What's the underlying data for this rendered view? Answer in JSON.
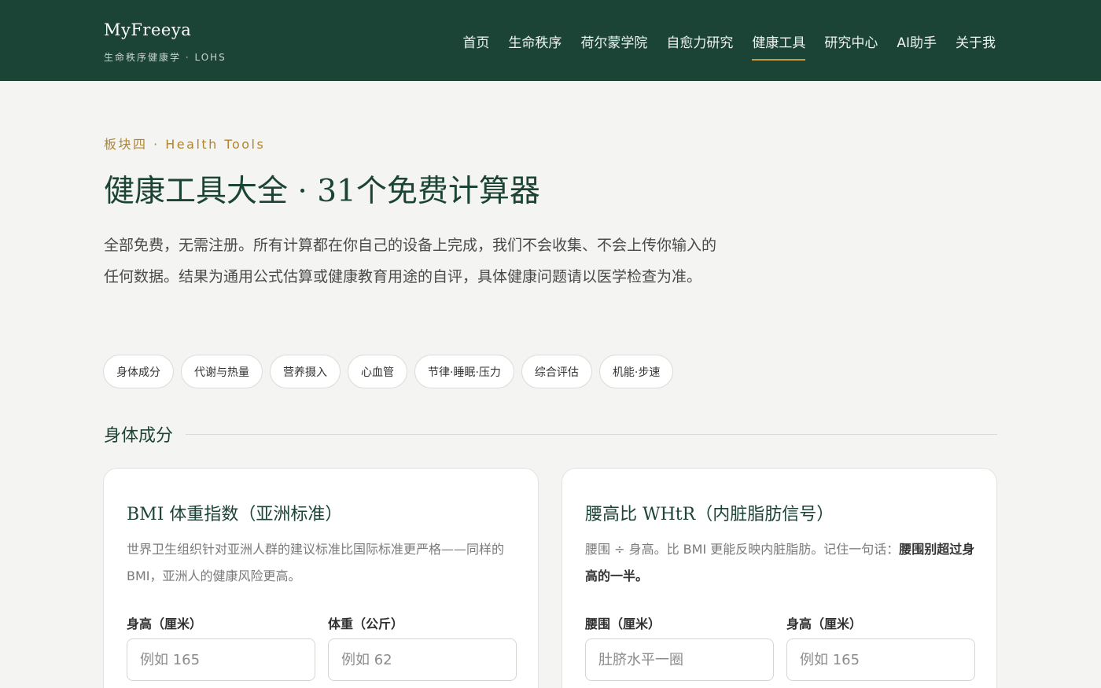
{
  "header": {
    "brand": "MyFreeya",
    "subtitle": "生命秩序健康学 · LOHS",
    "nav": [
      "首页",
      "生命秩序",
      "荷尔蒙学院",
      "自愈力研究",
      "健康工具",
      "研究中心",
      "AI助手",
      "关于我"
    ],
    "active_nav": "健康工具"
  },
  "hero": {
    "eyebrow": "板块四 · Health Tools",
    "title": "健康工具大全 · 31个免费计算器",
    "description": "全部免费，无需注册。所有计算都在你自己的设备上完成，我们不会收集、不会上传你输入的任何数据。结果为通用公式估算或健康教育用途的自评，具体健康问题请以医学检查为准。"
  },
  "categories": [
    "身体成分",
    "代谢与热量",
    "营养摄入",
    "心血管",
    "节律·睡眠·压力",
    "综合评估",
    "机能·步速"
  ],
  "section": {
    "title": "身体成分"
  },
  "cards": [
    {
      "title": "BMI 体重指数（亚洲标准）",
      "description": "世界卫生组织针对亚洲人群的建议标准比国际标准更严格——同样的 BMI，亚洲人的健康风险更高。",
      "fields": [
        {
          "label": "身高（厘米）",
          "placeholder": "例如 165"
        },
        {
          "label": "体重（公斤）",
          "placeholder": "例如 62"
        }
      ]
    },
    {
      "title": "腰高比 WHtR（内脏脂肪信号）",
      "description_prefix": "腰围 ÷ 身高。比 BMI 更能反映内脏脂肪。记住一句话：",
      "description_emphasis": "腰围别超过身高的一半。",
      "fields": [
        {
          "label": "腰围（厘米）",
          "placeholder": "肚脐水平一圈"
        },
        {
          "label": "身高（厘米）",
          "placeholder": "例如 165"
        }
      ]
    }
  ]
}
